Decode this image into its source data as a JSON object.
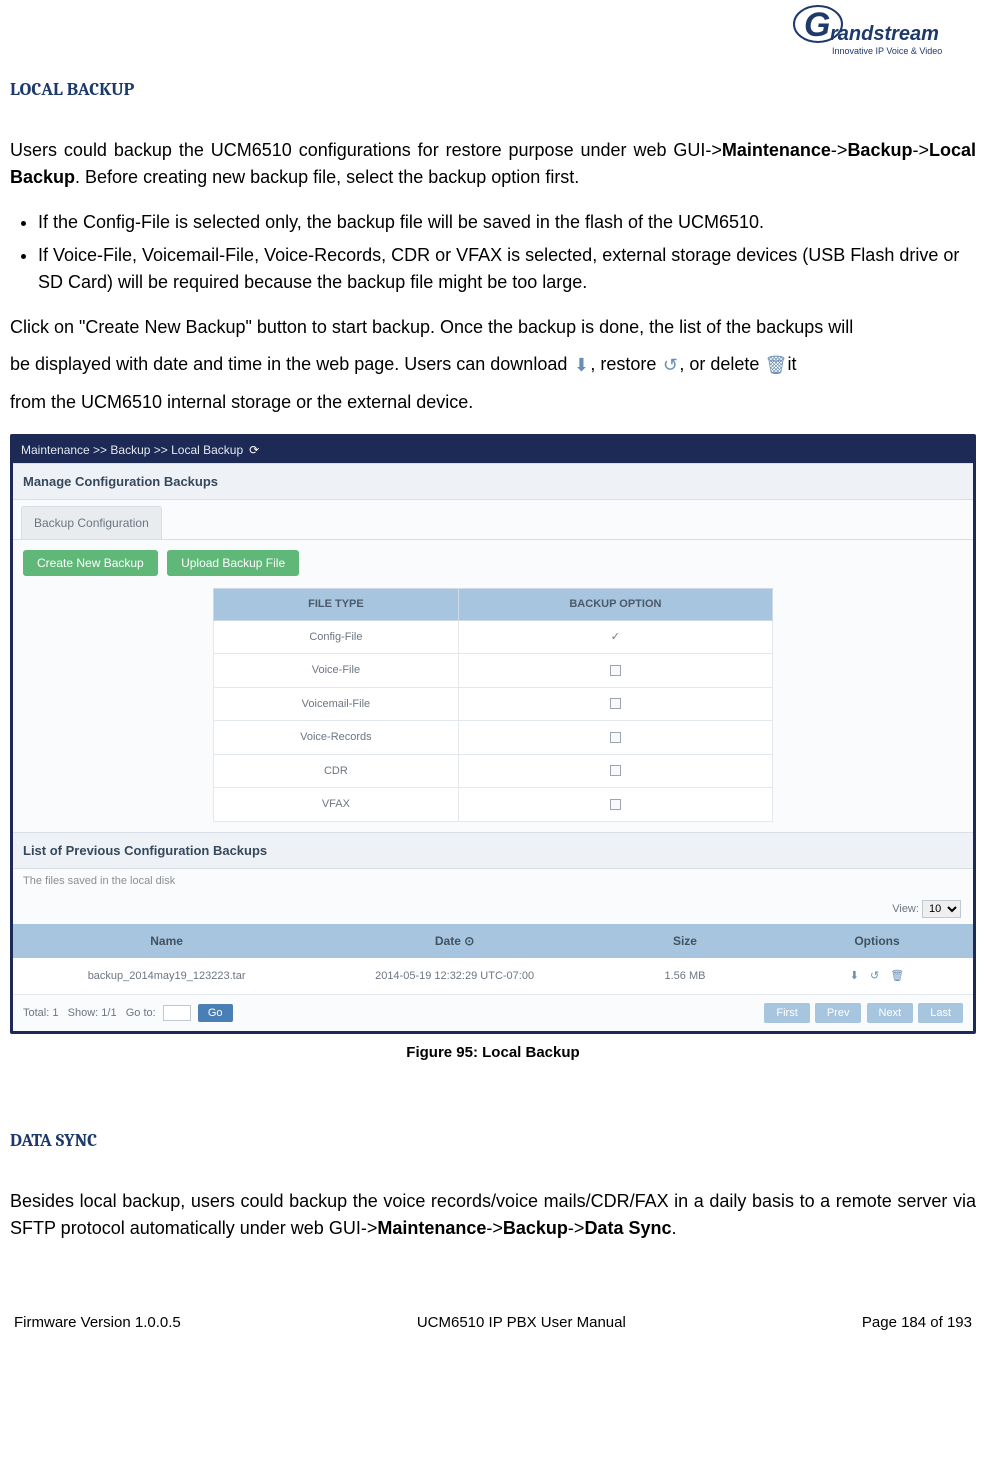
{
  "logo": {
    "brand": "Grandstream",
    "tagline": "Innovative IP Voice & Video"
  },
  "section1": {
    "heading": "LOCAL BACKUP",
    "p1_a": "Users could backup the UCM6510 configurations for restore purpose under web GUI->",
    "p1_b": "Maintenance",
    "p1_c": "->",
    "p1_d": "Backup",
    "p1_e": "->",
    "p1_f": "Local Backup",
    "p1_g": ". Before creating new backup file, select the backup option first.",
    "b1": "If the Config-File is selected only, the backup file will be saved in the flash of the UCM6510.",
    "b2": "If Voice-File, Voicemail-File, Voice-Records, CDR or VFAX is selected, external storage devices (USB Flash drive or SD Card) will be required because the backup file might be too large.",
    "p2_a": "Click on \"Create New Backup\" button to start backup. Once the backup is done, the list of the backups will",
    "p2_b": "be displayed with date and time in the web page. Users can download ",
    "p2_c": ", restore ",
    "p2_d": ", or delete ",
    "p2_e": " it",
    "p2_f": "from the UCM6510 internal storage or the external device."
  },
  "screenshot": {
    "breadcrumb": "Maintenance >> Backup >> Local Backup",
    "section_manage": "Manage Configuration Backups",
    "tab_config": "Backup Configuration",
    "btn_create": "Create New Backup",
    "btn_upload": "Upload Backup File",
    "th_ftype": "FILE TYPE",
    "th_bopt": "BACKUP OPTION",
    "rows": [
      {
        "ftype": "Config-File",
        "checked": true
      },
      {
        "ftype": "Voice-File",
        "checked": false
      },
      {
        "ftype": "Voicemail-File",
        "checked": false
      },
      {
        "ftype": "Voice-Records",
        "checked": false
      },
      {
        "ftype": "CDR",
        "checked": false
      },
      {
        "ftype": "VFAX",
        "checked": false
      }
    ],
    "section_list": "List of Previous Configuration Backups",
    "files_note": "The files saved in the local disk",
    "view_label": "View:",
    "view_value": "10",
    "mth_name": "Name",
    "mth_date": "Date",
    "mth_size": "Size",
    "mth_opts": "Options",
    "mrow": {
      "name": "backup_2014may19_123223.tar",
      "date": "2014-05-19 12:32:29 UTC-07:00",
      "size": "1.56 MB"
    },
    "pager_total": "Total: 1",
    "pager_show": "Show: 1/1",
    "pager_goto": "Go to:",
    "pager_go": "Go",
    "nav_first": "First",
    "nav_prev": "Prev",
    "nav_next": "Next",
    "nav_last": "Last"
  },
  "caption": "Figure 95: Local Backup",
  "section2": {
    "heading": "DATA SYNC",
    "p1_a": "Besides local backup, users could backup the voice records/voice mails/CDR/FAX in a daily basis to a remote server via SFTP protocol automatically under web GUI->",
    "p1_b": "Maintenance",
    "p1_c": "->",
    "p1_d": "Backup",
    "p1_e": "->",
    "p1_f": "Data Sync",
    "p1_g": "."
  },
  "footer": {
    "left": "Firmware Version 1.0.0.5",
    "center": "UCM6510 IP PBX User Manual",
    "right": "Page 184 of 193"
  }
}
